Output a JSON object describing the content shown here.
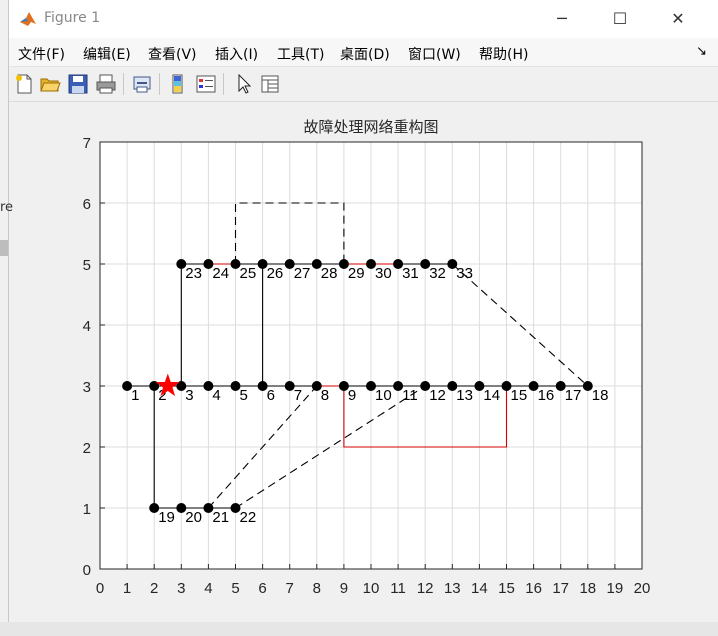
{
  "window": {
    "title": "Figure 1",
    "buttons": {
      "minimize": "─",
      "maximize": "☐",
      "close": "✕"
    }
  },
  "menubar": {
    "items": [
      "文件(F)",
      "编辑(E)",
      "查看(V)",
      "插入(I)",
      "工具(T)",
      "桌面(D)",
      "窗口(W)",
      "帮助(H)"
    ],
    "overflow": "↘"
  },
  "toolbar": {
    "icons": [
      "new-figure-icon",
      "open-file-icon",
      "save-icon",
      "print-icon",
      "link-plot-icon",
      "colorbar-icon",
      "legend-icon",
      "edit-plot-arrow-icon",
      "property-inspector-icon"
    ]
  },
  "left_strip": {
    "clipped_text": "re"
  },
  "colors": {
    "figure_bg": "#f0f0f0",
    "axes_bg": "#ffffff",
    "grid": "#dcdcdc",
    "node": "#000000",
    "red_line": "#d40000",
    "star": "#ff0000"
  },
  "chart_data": {
    "type": "scatter",
    "title": "故障处理网络重构图",
    "xlabel": "",
    "ylabel": "",
    "xlim": [
      0,
      20
    ],
    "ylim": [
      0,
      7
    ],
    "xticks": [
      0,
      1,
      2,
      3,
      4,
      5,
      6,
      7,
      8,
      9,
      10,
      11,
      12,
      13,
      14,
      15,
      16,
      17,
      18,
      19,
      20
    ],
    "yticks": [
      0,
      1,
      2,
      3,
      4,
      5,
      6,
      7
    ],
    "grid": true,
    "nodes": [
      {
        "id": "1",
        "x": 1,
        "y": 3
      },
      {
        "id": "2",
        "x": 2,
        "y": 3
      },
      {
        "id": "3",
        "x": 3,
        "y": 3
      },
      {
        "id": "4",
        "x": 4,
        "y": 3
      },
      {
        "id": "5",
        "x": 5,
        "y": 3
      },
      {
        "id": "6",
        "x": 6,
        "y": 3
      },
      {
        "id": "7",
        "x": 7,
        "y": 3
      },
      {
        "id": "8",
        "x": 8,
        "y": 3
      },
      {
        "id": "9",
        "x": 9,
        "y": 3
      },
      {
        "id": "10",
        "x": 10,
        "y": 3
      },
      {
        "id": "11",
        "x": 11,
        "y": 3
      },
      {
        "id": "12",
        "x": 12,
        "y": 3
      },
      {
        "id": "13",
        "x": 13,
        "y": 3
      },
      {
        "id": "14",
        "x": 14,
        "y": 3
      },
      {
        "id": "15",
        "x": 15,
        "y": 3
      },
      {
        "id": "16",
        "x": 16,
        "y": 3
      },
      {
        "id": "17",
        "x": 17,
        "y": 3
      },
      {
        "id": "18",
        "x": 18,
        "y": 3
      },
      {
        "id": "19",
        "x": 2,
        "y": 1
      },
      {
        "id": "20",
        "x": 3,
        "y": 1
      },
      {
        "id": "21",
        "x": 4,
        "y": 1
      },
      {
        "id": "22",
        "x": 5,
        "y": 1
      },
      {
        "id": "23",
        "x": 3,
        "y": 5
      },
      {
        "id": "24",
        "x": 4,
        "y": 5
      },
      {
        "id": "25",
        "x": 5,
        "y": 5
      },
      {
        "id": "26",
        "x": 6,
        "y": 5
      },
      {
        "id": "27",
        "x": 7,
        "y": 5
      },
      {
        "id": "28",
        "x": 8,
        "y": 5
      },
      {
        "id": "29",
        "x": 9,
        "y": 5
      },
      {
        "id": "30",
        "x": 10,
        "y": 5
      },
      {
        "id": "31",
        "x": 11,
        "y": 5
      },
      {
        "id": "32",
        "x": 12,
        "y": 5
      },
      {
        "id": "33",
        "x": 13,
        "y": 5
      }
    ],
    "lines": [
      {
        "style": "solid",
        "color": "black",
        "points": [
          [
            1,
            3
          ],
          [
            8,
            3
          ]
        ]
      },
      {
        "style": "solid",
        "color": "red",
        "points": [
          [
            8,
            3
          ],
          [
            9,
            3
          ]
        ]
      },
      {
        "style": "solid",
        "color": "black",
        "points": [
          [
            9,
            3
          ],
          [
            18,
            3
          ]
        ]
      },
      {
        "style": "solid",
        "color": "black",
        "points": [
          [
            2,
            3
          ],
          [
            2,
            1
          ],
          [
            5,
            1
          ]
        ]
      },
      {
        "style": "solid",
        "color": "black",
        "points": [
          [
            3,
            3
          ],
          [
            3,
            5
          ],
          [
            4,
            5
          ]
        ]
      },
      {
        "style": "solid",
        "color": "red",
        "points": [
          [
            4,
            5
          ],
          [
            5,
            5
          ]
        ]
      },
      {
        "style": "solid",
        "color": "black",
        "points": [
          [
            5,
            5
          ],
          [
            9,
            5
          ]
        ]
      },
      {
        "style": "solid",
        "color": "red",
        "points": [
          [
            9,
            5
          ],
          [
            11,
            5
          ]
        ]
      },
      {
        "style": "solid",
        "color": "black",
        "points": [
          [
            11,
            5
          ],
          [
            13,
            5
          ]
        ]
      },
      {
        "style": "solid",
        "color": "black",
        "points": [
          [
            6,
            5
          ],
          [
            6,
            3
          ]
        ]
      },
      {
        "style": "solid",
        "color": "red",
        "points": [
          [
            9,
            3
          ],
          [
            9,
            2
          ],
          [
            15,
            2
          ],
          [
            15,
            3
          ]
        ]
      },
      {
        "style": "dashed",
        "color": "black",
        "points": [
          [
            5,
            5
          ],
          [
            5,
            6
          ],
          [
            9,
            6
          ],
          [
            9,
            5
          ]
        ]
      },
      {
        "style": "dashed",
        "color": "black",
        "points": [
          [
            13,
            5
          ],
          [
            18,
            3
          ]
        ]
      },
      {
        "style": "dashed",
        "color": "black",
        "points": [
          [
            4,
            1
          ],
          [
            8,
            3
          ]
        ]
      },
      {
        "style": "dashed",
        "color": "black",
        "points": [
          [
            5,
            1
          ],
          [
            12,
            3
          ]
        ]
      }
    ],
    "fault_marker": {
      "shape": "star",
      "color": "red",
      "x": 2.5,
      "y": 3
    }
  }
}
